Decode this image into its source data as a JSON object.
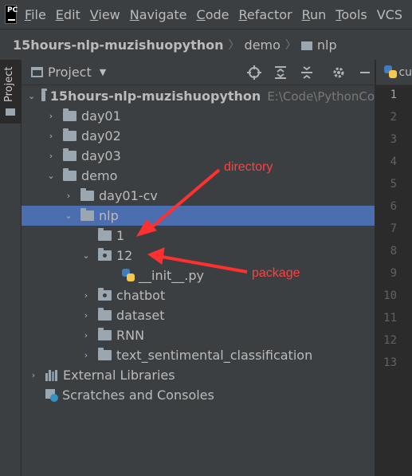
{
  "menu": {
    "logo": "PC",
    "items": [
      {
        "mnemonic": "F",
        "rest": "ile"
      },
      {
        "mnemonic": "E",
        "rest": "dit"
      },
      {
        "mnemonic": "V",
        "rest": "iew"
      },
      {
        "mnemonic": "N",
        "rest": "avigate"
      },
      {
        "mnemonic": "C",
        "rest": "ode"
      },
      {
        "mnemonic": "R",
        "rest": "efactor"
      },
      {
        "mnemonic": "R",
        "rest": "un"
      },
      {
        "mnemonic": "T",
        "rest": "ools"
      },
      {
        "mnemonic": "",
        "rest": "VCS"
      }
    ]
  },
  "breadcrumb": {
    "project": "15hours-nlp-muzishuopython",
    "items": [
      "demo",
      "nlp"
    ]
  },
  "sidebar_tab": {
    "label": "Project"
  },
  "panel": {
    "title": "Project"
  },
  "tree": {
    "root": {
      "label": "15hours-nlp-muzishuopython",
      "path": "E:\\Code\\PythonCo"
    },
    "day01": "day01",
    "day02": "day02",
    "day03": "day03",
    "demo": "demo",
    "day01cv": "day01-cv",
    "nlp": "nlp",
    "dir1": "1",
    "pkg12": "12",
    "init": "__init__.py",
    "chatbot": "chatbot",
    "dataset": "dataset",
    "rnn": "RNN",
    "textsent": "text_sentimental_classification",
    "extlib": "External Libraries",
    "scratches": "Scratches and Consoles"
  },
  "editor": {
    "tab": "cu",
    "line_numbers": [
      "1",
      "2",
      "3",
      "4",
      "5",
      "6",
      "7",
      "8",
      "9",
      "10",
      "11",
      "12",
      "13"
    ]
  },
  "annotations": {
    "directory": "directory",
    "package": "package",
    "color": "#ff3030"
  },
  "colors": {
    "selection": "#4b6eaf",
    "background": "#3c3f41",
    "editor": "#2b2b2b"
  }
}
